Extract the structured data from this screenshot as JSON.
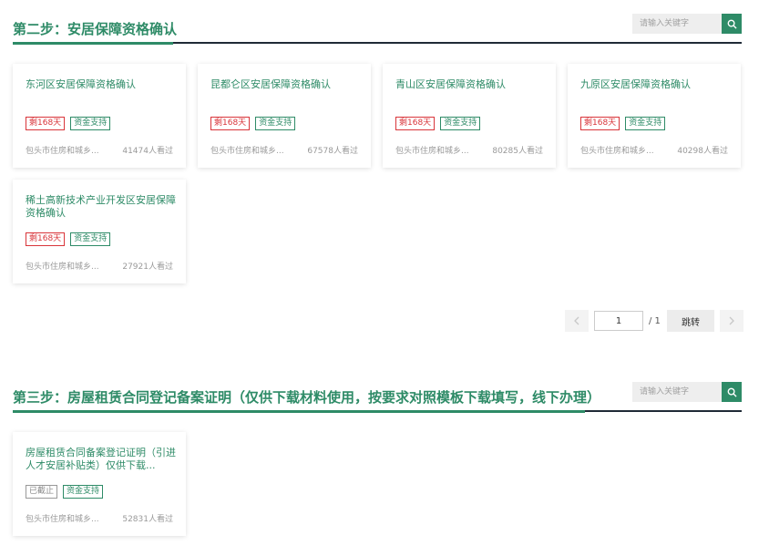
{
  "colors": {
    "accent": "#2e8b67",
    "dark_rule": "#1f2a36",
    "red": "#d9353a"
  },
  "section1": {
    "title": "第二步：安居保障资格确认",
    "search_placeholder": "请输入关键字",
    "search_icon": "search-icon",
    "cards": [
      {
        "title": "东河区安居保障资格确认",
        "tag_status": "剩168天",
        "tag_type": "资金支持",
        "org": "包头市住房和城乡...",
        "views": "41474人看过"
      },
      {
        "title": "昆都仑区安居保障资格确认",
        "tag_status": "剩168天",
        "tag_type": "资金支持",
        "org": "包头市住房和城乡...",
        "views": "67578人看过"
      },
      {
        "title": "青山区安居保障资格确认",
        "tag_status": "剩168天",
        "tag_type": "资金支持",
        "org": "包头市住房和城乡...",
        "views": "80285人看过"
      },
      {
        "title": "九原区安居保障资格确认",
        "tag_status": "剩168天",
        "tag_type": "资金支持",
        "org": "包头市住房和城乡...",
        "views": "40298人看过"
      },
      {
        "title": "稀土高新技术产业开发区安居保障资格确认",
        "tag_status": "剩168天",
        "tag_type": "资金支持",
        "org": "包头市住房和城乡...",
        "views": "27921人看过"
      }
    ]
  },
  "pagination": {
    "current": "1",
    "total": "/ 1",
    "jump_label": "跳转"
  },
  "section2": {
    "title": "第三步：房屋租赁合同登记备案证明（仅供下载材料使用，按要求对照模板下载填写，线下办理）",
    "search_placeholder": "请输入关键字",
    "search_icon": "search-icon",
    "cards": [
      {
        "title": "房屋租赁合同备案登记证明（引进人才安居补贴类）仅供下载...",
        "tag_status": "已截止",
        "tag_type": "资金支持",
        "org": "包头市住房和城乡...",
        "views": "52831人看过"
      }
    ]
  }
}
